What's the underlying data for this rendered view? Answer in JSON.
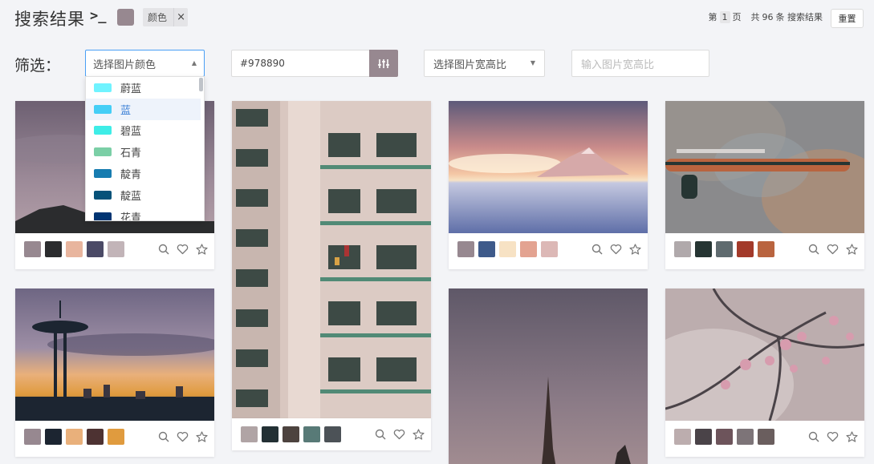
{
  "header": {
    "title": "搜索结果",
    "prompt": ">_",
    "selected_color": "#978890",
    "tag_label": "颜色",
    "tag_close": "×",
    "pager_prefix": "第",
    "page": "1",
    "pager_page_unit": "页",
    "pager_total_prefix": "共",
    "total": "96",
    "pager_total_suffix": "条 搜索结果",
    "reset_label": "重置"
  },
  "filters": {
    "label": "筛选：",
    "color_select_placeholder": "选择图片颜色",
    "hex_value": "#978890",
    "hex_button_icon": "sliders-icon",
    "ratio_select_placeholder": "选择图片宽高比",
    "ratio_input_placeholder": "输入图片宽高比"
  },
  "color_options": [
    {
      "name": "蔚蓝",
      "color": "#70f3ff"
    },
    {
      "name": "蓝",
      "color": "#44cef6"
    },
    {
      "name": "碧蓝",
      "color": "#3eede7"
    },
    {
      "name": "石青",
      "color": "#7bcfa6"
    },
    {
      "name": "靛青",
      "color": "#177cb0"
    },
    {
      "name": "靛蓝",
      "color": "#065279"
    },
    {
      "name": "花青",
      "color": "#003472"
    }
  ],
  "cards": [
    {
      "subject": "dusk-mountain",
      "palette": [
        "#978890",
        "#2b2c2e",
        "#e8b59e",
        "#4b4a66",
        "#c2b4b8"
      ]
    },
    {
      "subject": "apartment-building",
      "palette": []
    },
    {
      "subject": "sunset-snow-mountain",
      "palette": [
        "#978890",
        "#3e5a8a",
        "#f7e2c4",
        "#e3a391",
        "#dcb8b6"
      ]
    },
    {
      "subject": "bicycle-wheel",
      "palette": [
        "#b0a9ab",
        "#263533",
        "#5f6b6f",
        "#a33a2a",
        "#b9643f"
      ]
    },
    {
      "subject": "space-needle-sunset",
      "palette": [
        "#978890",
        "#1c2531",
        "#e9b07b",
        "#4d3232",
        "#e09b3e"
      ]
    },
    {
      "subject": "building-bottom",
      "palette": [
        "#b0a4a5",
        "#233034",
        "#4d433f",
        "#587a77",
        "#4c5257"
      ]
    },
    {
      "subject": "spire-dusk",
      "palette": []
    },
    {
      "subject": "cherry-blossom",
      "palette": [
        "#bcadae",
        "#4a4348",
        "#6d545b",
        "#7d7478",
        "#6a5e5e"
      ]
    }
  ],
  "card_actions": [
    "zoom-icon",
    "heart-icon",
    "star-icon"
  ]
}
